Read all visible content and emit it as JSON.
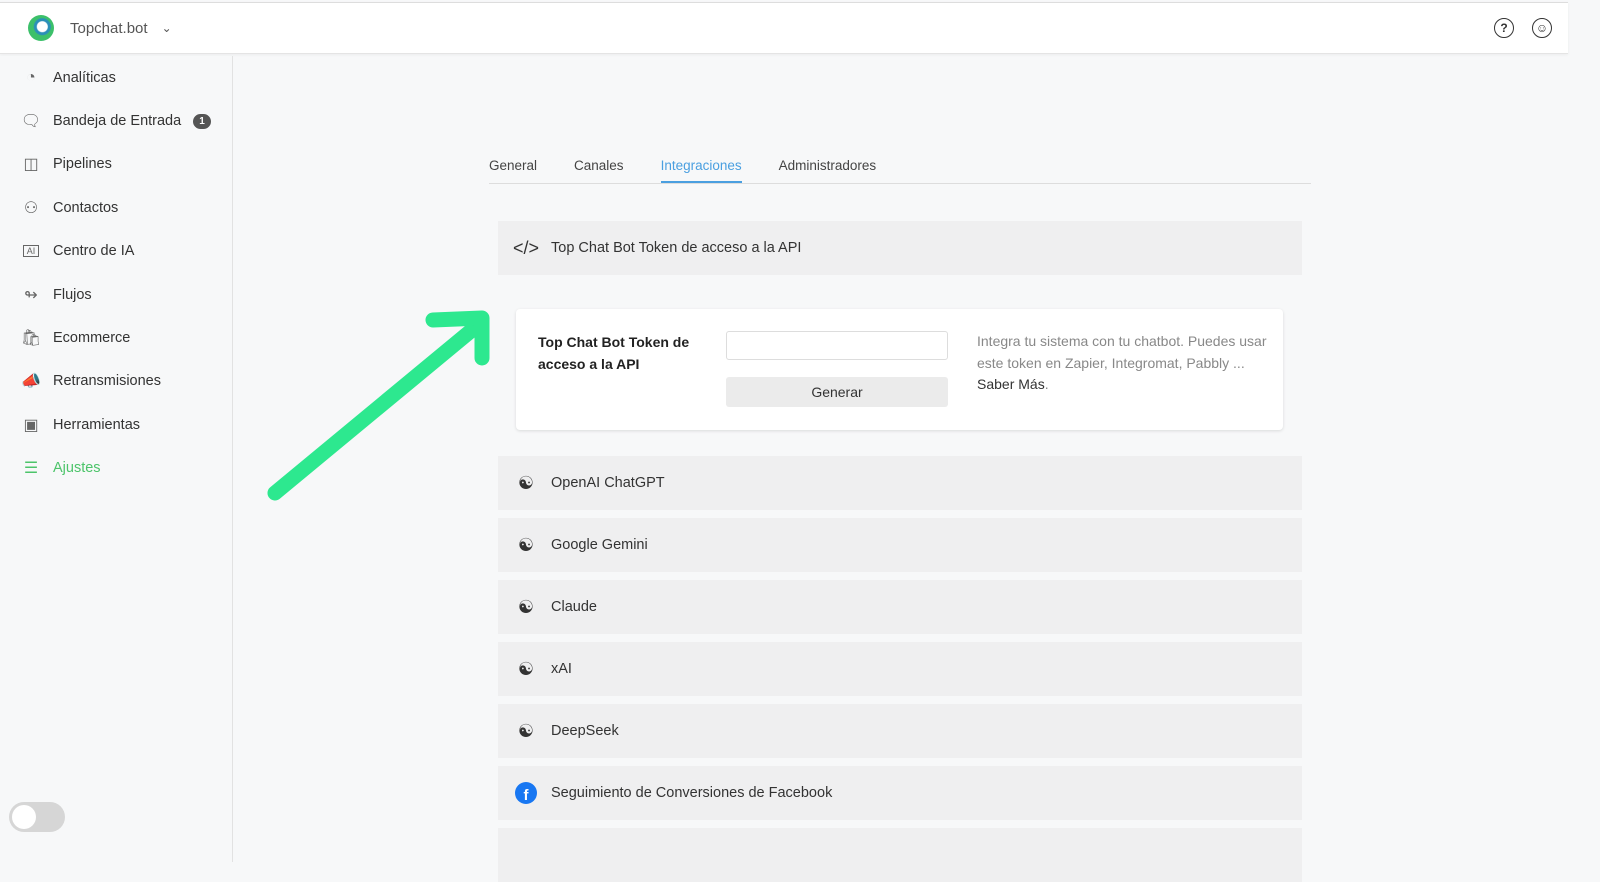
{
  "header": {
    "brand": "Topchat.bot"
  },
  "sidebar": {
    "items": [
      {
        "label": "Analíticas",
        "icon": "pie-chart-icon"
      },
      {
        "label": "Bandeja de Entrada",
        "icon": "chat-icon",
        "badge": "1"
      },
      {
        "label": "Pipelines",
        "icon": "columns-icon"
      },
      {
        "label": "Contactos",
        "icon": "users-icon"
      },
      {
        "label": "Centro de IA",
        "icon": "ai-chip-icon"
      },
      {
        "label": "Flujos",
        "icon": "flow-icon"
      },
      {
        "label": "Ecommerce",
        "icon": "bag-icon"
      },
      {
        "label": "Retransmisiones",
        "icon": "megaphone-icon"
      },
      {
        "label": "Herramientas",
        "icon": "toolbox-icon"
      },
      {
        "label": "Ajustes",
        "icon": "sliders-icon",
        "active": true
      }
    ]
  },
  "tabs": [
    "General",
    "Canales",
    "Integraciones",
    "Administradores"
  ],
  "active_tab": "Integraciones",
  "api_section": {
    "title": "Top Chat Bot Token de acceso a la API",
    "label": "Top Chat Bot Token de acceso a la API",
    "input_value": "",
    "button": "Generar",
    "description": "Integra tu sistema con tu chatbot. Puedes usar este token en Zapier, Integromat, Pabbly ...",
    "link": "Saber Más"
  },
  "integrations": [
    "OpenAI ChatGPT",
    "Google Gemini",
    "Claude",
    "xAI",
    "DeepSeek",
    "Seguimiento de Conversiones de Facebook"
  ],
  "colors": {
    "accent": "#4cc46a",
    "tab_active": "#4a9fe0",
    "arrow": "#2de88f"
  }
}
